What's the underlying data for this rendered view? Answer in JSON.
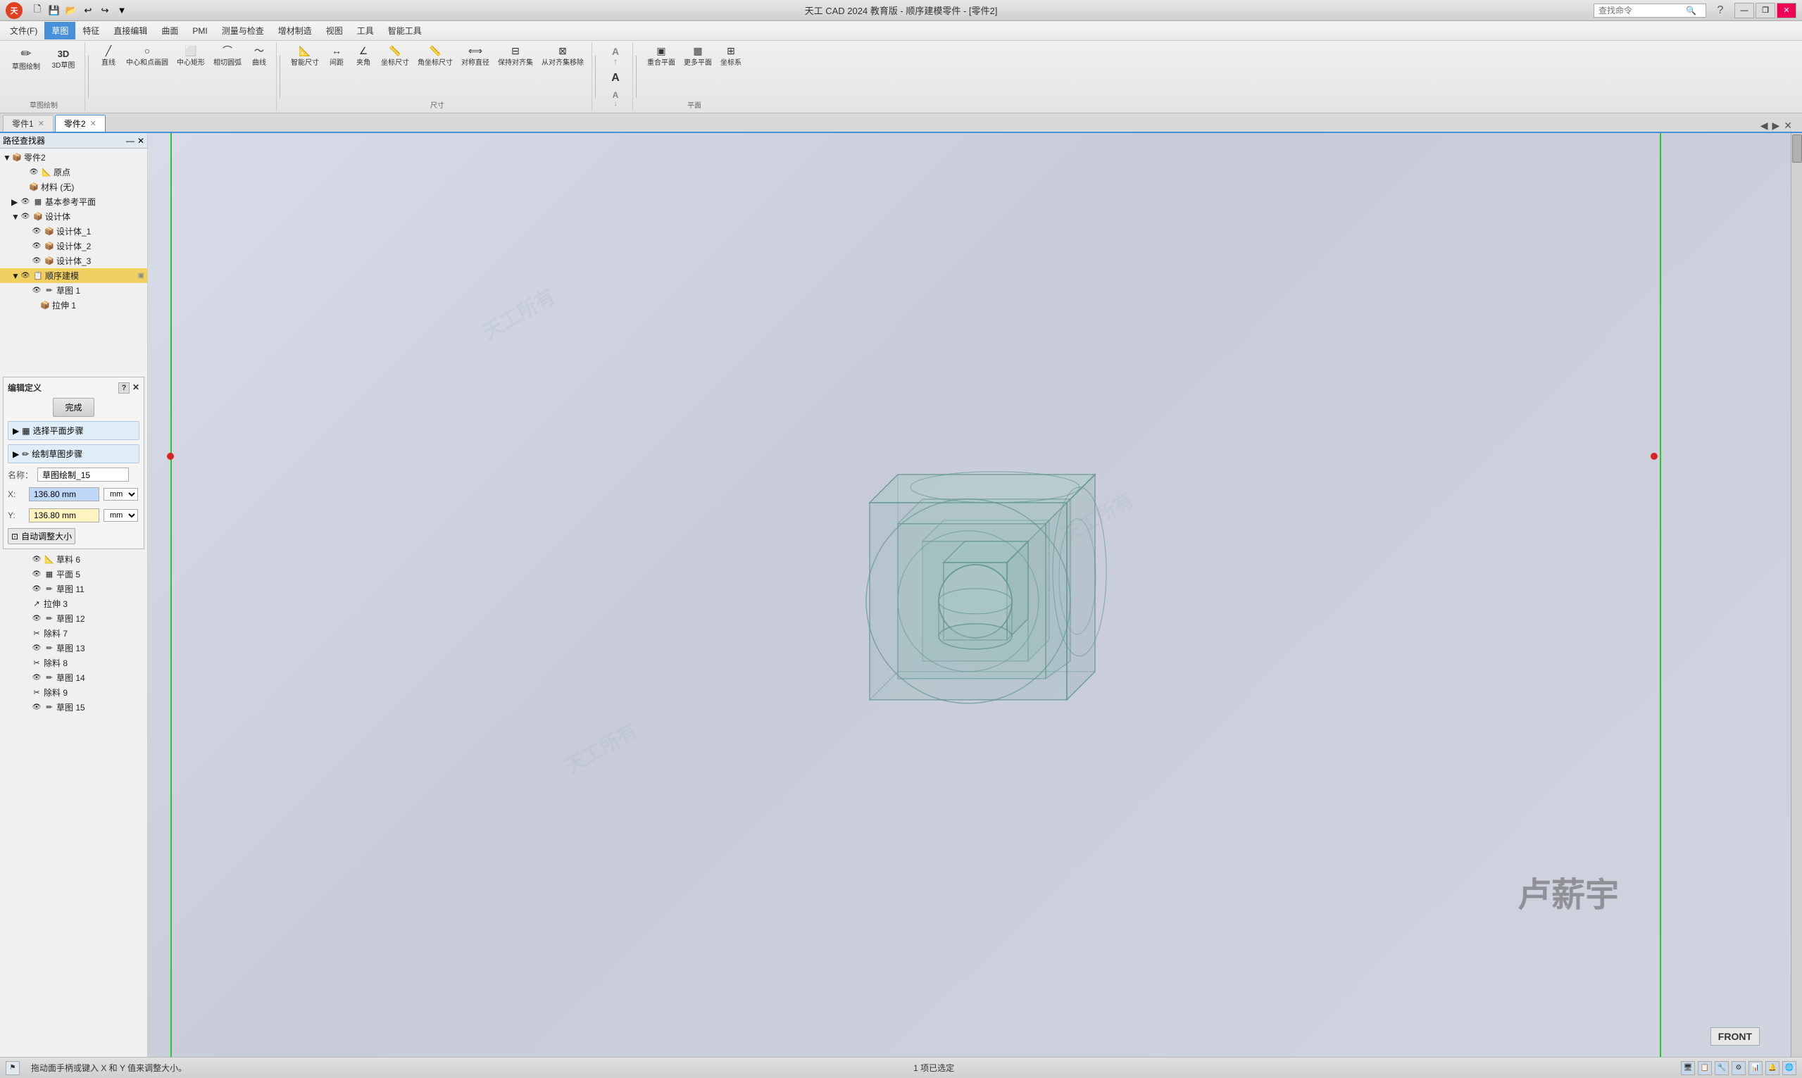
{
  "app": {
    "title": "天工 CAD 2024 教育版 - 顺序建模零件 - [零件2]",
    "logo_text": "天"
  },
  "window_controls": {
    "minimize": "—",
    "restore": "❐",
    "close": "✕",
    "inner_minimize": "—",
    "inner_restore": "❐",
    "inner_close": "✕"
  },
  "menu": {
    "items": [
      {
        "label": "文件(F)",
        "active": false
      },
      {
        "label": "草图",
        "active": true
      },
      {
        "label": "特征",
        "active": false
      },
      {
        "label": "直接编辑",
        "active": false
      },
      {
        "label": "曲面",
        "active": false
      },
      {
        "label": "PMI",
        "active": false
      },
      {
        "label": "测量与检查",
        "active": false
      },
      {
        "label": "增材制造",
        "active": false
      },
      {
        "label": "视图",
        "active": false
      },
      {
        "label": "工具",
        "active": false
      },
      {
        "label": "智能工具",
        "active": false
      }
    ]
  },
  "search": {
    "placeholder": "查找命令"
  },
  "toolbar": {
    "groups": [
      {
        "name": "草图绘制",
        "items": [
          {
            "icon": "✏️",
            "label": "草图绘制",
            "large": true
          },
          {
            "icon": "3D",
            "label": "3D草图",
            "large": true
          }
        ],
        "label": "草图绘制"
      },
      {
        "name": "基本绘图",
        "items": [
          {
            "icon": "╱",
            "label": "直线"
          },
          {
            "icon": "○",
            "label": "中心和点画圆"
          },
          {
            "icon": "⬜",
            "label": "中心矩形"
          },
          {
            "icon": "⌒",
            "label": "相切圆弧"
          },
          {
            "icon": "〜",
            "label": "曲线"
          }
        ],
        "label": ""
      },
      {
        "name": "智能尺寸",
        "items": [
          {
            "icon": "📐",
            "label": "智能尺寸"
          },
          {
            "icon": "↔",
            "label": "间距"
          },
          {
            "icon": "∠",
            "label": "夹角"
          },
          {
            "icon": "📏",
            "label": "坐标尺寸"
          },
          {
            "icon": "📏",
            "label": "角坐标尺寸"
          },
          {
            "icon": "⟺",
            "label": "对称直径"
          },
          {
            "icon": "⊟",
            "label": "保持对齐集"
          },
          {
            "icon": "⊠",
            "label": "从对齐集移除"
          }
        ],
        "label": "尺寸"
      },
      {
        "name": "A-tools",
        "items": [
          {
            "icon": "A↑",
            "label": ""
          },
          {
            "icon": "A",
            "label": ""
          },
          {
            "icon": "A↓",
            "label": ""
          }
        ],
        "label": ""
      },
      {
        "name": "平面",
        "items": [
          {
            "icon": "▣",
            "label": "重合平面"
          },
          {
            "icon": "▦",
            "label": "更多平面"
          },
          {
            "icon": "⊞",
            "label": "坐标系"
          }
        ],
        "label": "平面"
      }
    ]
  },
  "tabs": [
    {
      "label": "零件1",
      "active": false,
      "closable": true
    },
    {
      "label": "零件2",
      "active": true,
      "closable": true
    }
  ],
  "path_finder": {
    "title": "路径查找器",
    "minimize_icon": "—",
    "close_icon": "✕"
  },
  "tree": {
    "root": "零件2",
    "items": [
      {
        "level": 1,
        "icon": "⊕",
        "label": "原点",
        "has_arrow": false
      },
      {
        "level": 1,
        "icon": "📦",
        "label": "材料 (无)",
        "has_arrow": false
      },
      {
        "level": 1,
        "icon": "📐",
        "label": "基本参考平面",
        "has_arrow": true,
        "collapsed": true
      },
      {
        "level": 1,
        "icon": "🔷",
        "label": "设计体",
        "has_arrow": true,
        "expanded": true
      },
      {
        "level": 2,
        "icon": "📦",
        "label": "设计体_1",
        "has_arrow": false
      },
      {
        "level": 2,
        "icon": "📦",
        "label": "设计体_2",
        "has_arrow": false
      },
      {
        "level": 2,
        "icon": "📦",
        "label": "设计体_3",
        "has_arrow": false
      },
      {
        "level": 1,
        "icon": "📋",
        "label": "顺序建模",
        "has_arrow": true,
        "expanded": true,
        "highlighted": true
      },
      {
        "level": 2,
        "icon": "✏",
        "label": "草图 1",
        "has_arrow": false
      },
      {
        "level": 3,
        "icon": "📦",
        "label": "拉伸 1",
        "has_arrow": false
      },
      {
        "level": 2,
        "icon": "✏",
        "label": "...",
        "has_arrow": false
      }
    ]
  },
  "tree_bottom": {
    "items": [
      {
        "level": 2,
        "icon": "📐",
        "label": "草料 6",
        "has_arrow": false
      },
      {
        "level": 2,
        "icon": "▦",
        "label": "平面 5",
        "has_arrow": false
      },
      {
        "level": 2,
        "icon": "✏",
        "label": "草图 11",
        "has_arrow": false
      },
      {
        "level": 2,
        "icon": "↗",
        "label": "拉伸 3",
        "has_arrow": false
      },
      {
        "level": 2,
        "icon": "✏",
        "label": "草图 12",
        "has_arrow": false
      },
      {
        "level": 2,
        "icon": "✂",
        "label": "除料 7",
        "has_arrow": false
      },
      {
        "level": 2,
        "icon": "✏",
        "label": "草图 13",
        "has_arrow": false
      },
      {
        "level": 2,
        "icon": "✂",
        "label": "除料 8",
        "has_arrow": false
      },
      {
        "level": 2,
        "icon": "✏",
        "label": "草图 14",
        "has_arrow": false
      },
      {
        "level": 2,
        "icon": "✂",
        "label": "除料 9",
        "has_arrow": false
      },
      {
        "level": 2,
        "icon": "✏",
        "label": "草图 15",
        "has_arrow": false
      }
    ]
  },
  "edit_definition": {
    "title": "编辑定义",
    "help_icon": "?",
    "close_icon": "✕",
    "finish_btn": "完成",
    "steps": [
      {
        "icon": "▦",
        "label": "选择平面步骤"
      },
      {
        "icon": "✏",
        "label": "绘制草图步骤"
      }
    ],
    "name_label": "名称：",
    "name_value": "草图绘制_15",
    "x_label": "X:",
    "x_value": "136.80 mm",
    "y_label": "Y:",
    "y_value": "136.80 mm",
    "unit_dropdown": "mm",
    "auto_adjust": "自动调整大小"
  },
  "viewport": {
    "user_name": "卢薪宇",
    "front_label": "FRONT",
    "watermarks": [
      "天工所有",
      "天工所有",
      "天工所有",
      "天工所有"
    ]
  },
  "statusbar": {
    "message": "拖动面手柄或键入 X 和 Y 值来调整大小。",
    "status_icon": "⚑",
    "right_status": "1 项已选定",
    "icons": [
      "🖥",
      "📋",
      "🔧",
      "⚙",
      "📊",
      "🔔",
      "🌐"
    ]
  },
  "colors": {
    "accent": "#4a90d9",
    "active_menu_bg": "#4a90d9",
    "toolbar_bg": "#f0f0f0",
    "viewport_bg": "#c8ccd8",
    "highlight": "#f0d060",
    "green_line": "#22cc22",
    "red_dot": "#dd2222"
  }
}
